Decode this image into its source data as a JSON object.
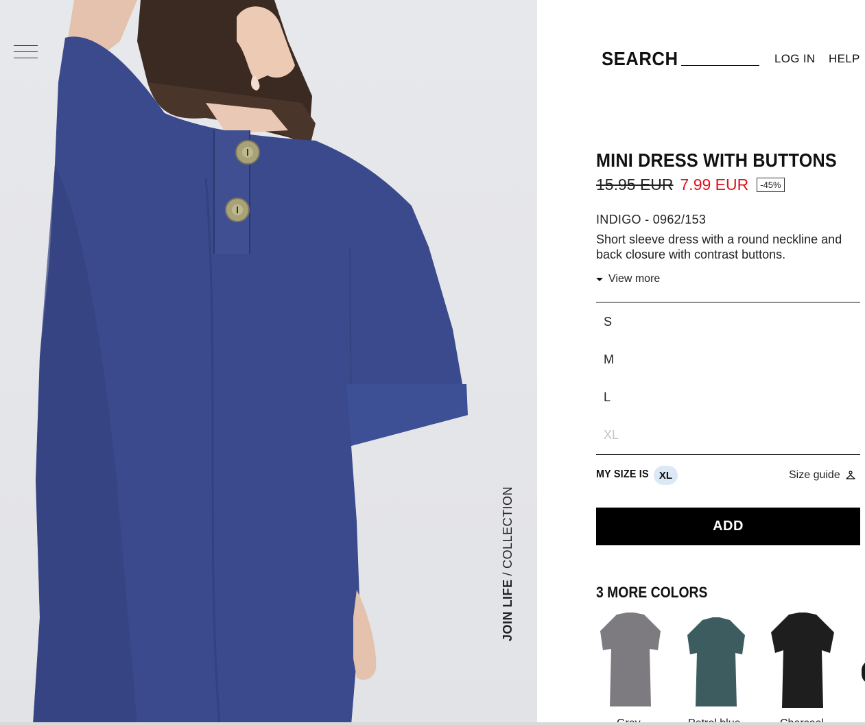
{
  "header": {
    "menu_icon": "hamburger-menu-icon",
    "search_label": "SEARCH",
    "search_value": "",
    "login": "LOG IN",
    "help": "HELP"
  },
  "hero": {
    "vertical_label_bold": "JOIN LIFE",
    "vertical_label_sep": "/",
    "vertical_label_rest": "COLLECTION"
  },
  "product": {
    "title": "MINI DRESS WITH BUTTONS",
    "old_price": "15.95 EUR",
    "new_price": "7.99 EUR",
    "discount": "-45%",
    "color_ref": "INDIGO - 0962/153",
    "description": "Short sleeve dress with a round neckline and back closure with contrast buttons.",
    "view_more": "View more",
    "sizes": [
      {
        "label": "S",
        "available": true
      },
      {
        "label": "M",
        "available": true
      },
      {
        "label": "L",
        "available": true
      },
      {
        "label": "XL",
        "available": false
      }
    ],
    "my_size_label": "MY SIZE IS",
    "my_size_value": "XL",
    "size_guide": "Size guide",
    "size_guide_icon": "hanger-icon",
    "add_label": "ADD",
    "more_colors_title": "3 MORE COLORS",
    "colors": [
      {
        "name": "Grey",
        "color": "#7d7b80"
      },
      {
        "name": "Petrol blue",
        "color": "#3d5c5f"
      },
      {
        "name": "Charcoal",
        "color": "#1e1e1f"
      }
    ]
  },
  "colors": {
    "sale_red": "#e10f1a",
    "dress_indigo": "#3a4a8c",
    "my_size_badge": "#dbe8f5"
  }
}
